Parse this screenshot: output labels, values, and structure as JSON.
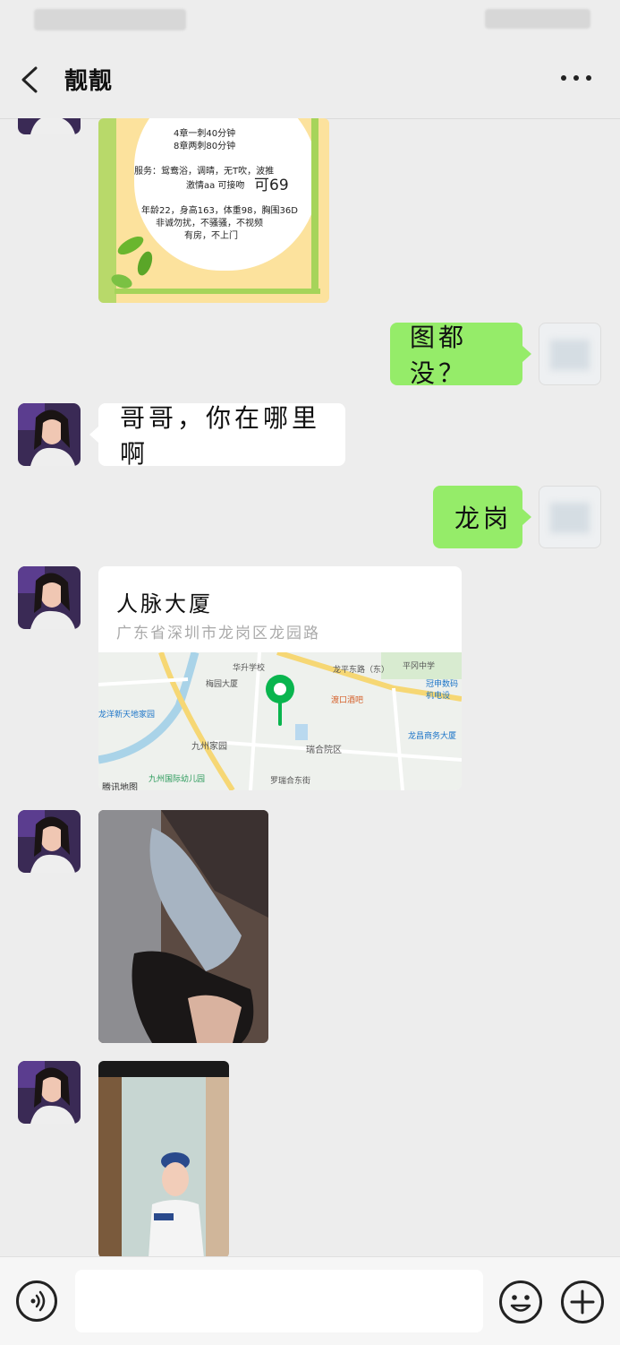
{
  "header": {
    "title": "靓靓"
  },
  "poster": {
    "lines": [
      "4章一刺40分钟",
      "8章两刺80分钟",
      "服务：鸳鸯浴，调晴，无T吹，波推",
      "激情aa   可接吻",
      "可69",
      "年龄22，身高163，体重98，胸围36D",
      "非诚勿扰，不骚骚，不视频",
      "有房，不上门"
    ]
  },
  "messages": {
    "m1": "图都没？",
    "m2": "哥哥，你在哪里啊",
    "m3": "龙岗"
  },
  "location": {
    "name": "人脉大厦",
    "address": "广东省深圳市龙岗区龙园路",
    "map_labels": [
      "华升学校",
      "梅园大厦",
      "龙平东路（东）",
      "平冈中学",
      "渡口酒吧",
      "冠申数码机电设",
      "九州家园",
      "瑞合院区",
      "龙昌商务大厦",
      "九州国际幼儿园",
      "龙洋新天地家园",
      "罗瑞合东街",
      "腾讯地图"
    ]
  }
}
